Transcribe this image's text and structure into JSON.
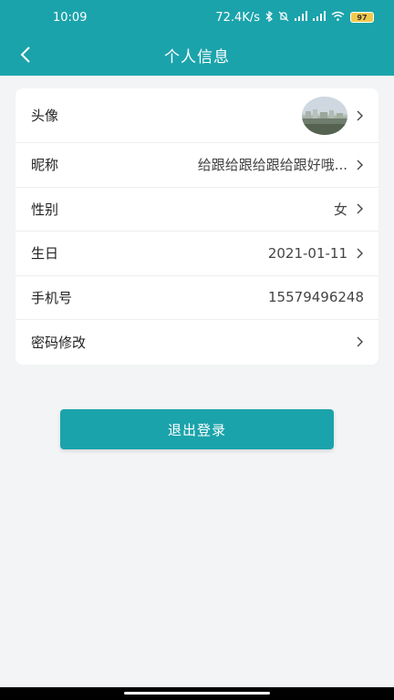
{
  "status_bar": {
    "time": "10:09",
    "network_speed": "72.4K/s",
    "battery": "97",
    "icons": [
      "bluetooth-icon",
      "mute-icon",
      "signal-icon",
      "signal-icon",
      "wifi-icon",
      "battery-icon"
    ]
  },
  "nav": {
    "title": "个人信息",
    "back_icon": "chevron-left-icon"
  },
  "profile": {
    "avatar_label": "头像",
    "nickname_label": "昵称",
    "nickname_value": "给跟给跟给跟给跟好哦...",
    "gender_label": "性别",
    "gender_value": "女",
    "birthday_label": "生日",
    "birthday_value": "2021-01-11",
    "phone_label": "手机号",
    "phone_value": "15579496248",
    "password_label": "密码修改"
  },
  "logout_label": "退出登录",
  "colors": {
    "primary": "#1ba3ab",
    "background": "#f3f4f6",
    "card": "#ffffff"
  }
}
